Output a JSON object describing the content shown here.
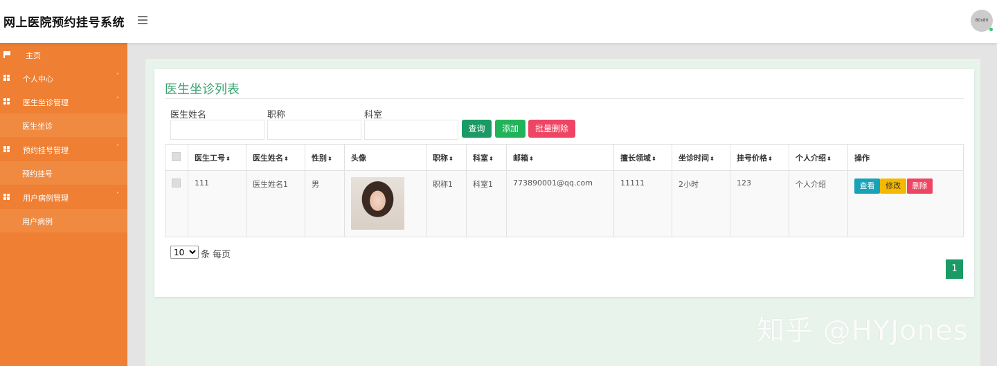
{
  "header": {
    "title": "网上医院预约挂号系统",
    "avatar_text": "80x80"
  },
  "sidebar": {
    "items": [
      {
        "label": "主页",
        "icon": "flag-icon"
      },
      {
        "label": "个人中心",
        "icon": "grid-icon",
        "caret": "˅"
      },
      {
        "label": "医生坐诊管理",
        "icon": "grid-icon",
        "caret": "˄"
      },
      {
        "label": "医生坐诊"
      },
      {
        "label": "预约挂号管理",
        "icon": "grid-icon",
        "caret": "˄"
      },
      {
        "label": "预约挂号"
      },
      {
        "label": "用户病例管理",
        "icon": "grid-icon",
        "caret": "˄"
      },
      {
        "label": "用户病例"
      }
    ]
  },
  "panel": {
    "title": "医生坐诊列表",
    "filters": [
      {
        "label": "医生姓名",
        "value": ""
      },
      {
        "label": "职称",
        "value": ""
      },
      {
        "label": "科室",
        "value": ""
      }
    ],
    "buttons": {
      "query": "查询",
      "add": "添加",
      "batch_delete": "批量删除"
    },
    "table": {
      "headers": [
        "医生工号",
        "医生姓名",
        "性别",
        "头像",
        "职称",
        "科室",
        "邮箱",
        "擅长领域",
        "坐诊时间",
        "挂号价格",
        "个人介绍",
        "操作"
      ],
      "sort_glyph": "⬍",
      "rows": [
        {
          "cells": [
            "111",
            "医生姓名1",
            "男",
            "",
            "职称1",
            "科室1",
            "773890001@qq.com",
            "11111",
            "2小时",
            "123",
            "个人介绍"
          ]
        }
      ],
      "actions": {
        "view": "查看",
        "edit": "修改",
        "delete": "删除"
      }
    },
    "pagination": {
      "page_size": "10",
      "page_size_suffix": "条 每页",
      "current_page": "1"
    }
  },
  "watermark": "知乎 @HYJones",
  "colors": {
    "sidebar": "#ee7f33",
    "accent_green": "#1a9a64",
    "title_green": "#3aa272",
    "danger": "#ef4565",
    "info": "#17a2b8",
    "warning": "#f5b800"
  }
}
